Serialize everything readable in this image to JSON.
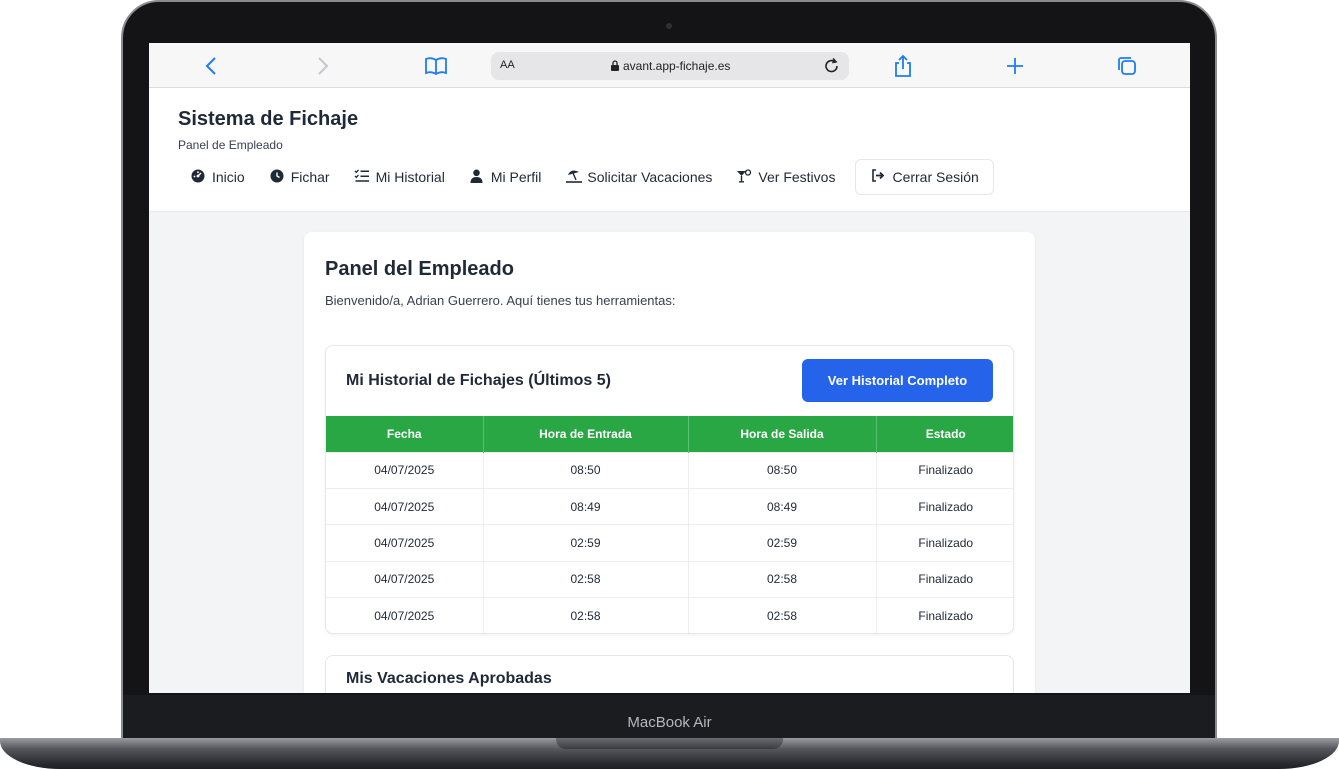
{
  "device": {
    "label": "MacBook Air"
  },
  "browser": {
    "text_size_label": "AA",
    "url": "avant.app-fichaje.es"
  },
  "header": {
    "title": "Sistema de Fichaje",
    "subtitle": "Panel de Empleado",
    "nav": [
      {
        "label": "Inicio",
        "icon": "dashboard-icon"
      },
      {
        "label": "Fichar",
        "icon": "clock-icon"
      },
      {
        "label": "Mi Historial",
        "icon": "list-check-icon"
      },
      {
        "label": "Mi Perfil",
        "icon": "user-icon"
      },
      {
        "label": "Solicitar Vacaciones",
        "icon": "umbrella-beach-icon"
      },
      {
        "label": "Ver Festivos",
        "icon": "cocktail-icon"
      }
    ],
    "logout": {
      "label": "Cerrar Sesión",
      "icon": "sign-out-icon"
    }
  },
  "main": {
    "title": "Panel del Empleado",
    "welcome": "Bienvenido/a, Adrian Guerrero. Aquí tienes tus herramientas:",
    "history": {
      "title": "Mi Historial de Fichajes (Últimos 5)",
      "button_label": "Ver Historial Completo",
      "columns": [
        "Fecha",
        "Hora de Entrada",
        "Hora de Salida",
        "Estado"
      ],
      "rows": [
        [
          "04/07/2025",
          "08:50",
          "08:50",
          "Finalizado"
        ],
        [
          "04/07/2025",
          "08:49",
          "08:49",
          "Finalizado"
        ],
        [
          "04/07/2025",
          "02:59",
          "02:59",
          "Finalizado"
        ],
        [
          "04/07/2025",
          "02:58",
          "02:58",
          "Finalizado"
        ],
        [
          "04/07/2025",
          "02:58",
          "02:58",
          "Finalizado"
        ]
      ]
    },
    "vacations": {
      "title": "Mis Vacaciones Aprobadas"
    }
  },
  "colors": {
    "primary_button": "#2563eb",
    "table_header": "#2aa745",
    "browser_accent": "#1f7cf5"
  }
}
